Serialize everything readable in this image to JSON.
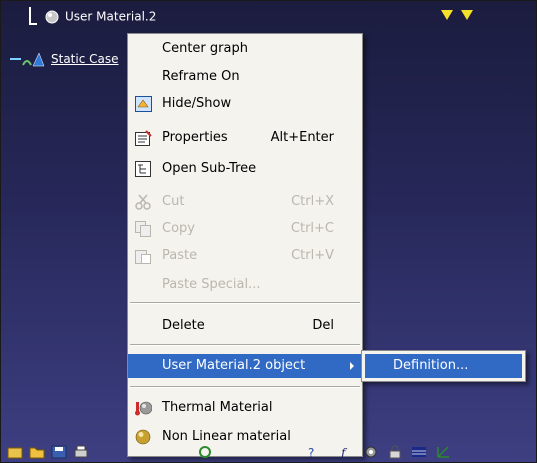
{
  "tree": {
    "material_node": "User Material.2",
    "case_node": "Static Case"
  },
  "menu": {
    "center_graph": "Center graph",
    "reframe_on": "Reframe On",
    "hide_show": "Hide/Show",
    "properties": "Properties",
    "properties_shortcut": "Alt+Enter",
    "open_sub_tree": "Open Sub-Tree",
    "cut": "Cut",
    "cut_shortcut": "Ctrl+X",
    "copy": "Copy",
    "copy_shortcut": "Ctrl+C",
    "paste": "Paste",
    "paste_shortcut": "Ctrl+V",
    "paste_special": "Paste Special...",
    "delete": "Delete",
    "delete_shortcut": "Del",
    "object_submenu": "User Material.2 object",
    "thermal_material": "Thermal Material",
    "non_linear_material": "Non Linear material"
  },
  "submenu": {
    "definition": "Definition..."
  },
  "colors": {
    "highlight": "#316ac5",
    "menu_background": "#f4f3ee",
    "viewer_background": "#27285a"
  }
}
